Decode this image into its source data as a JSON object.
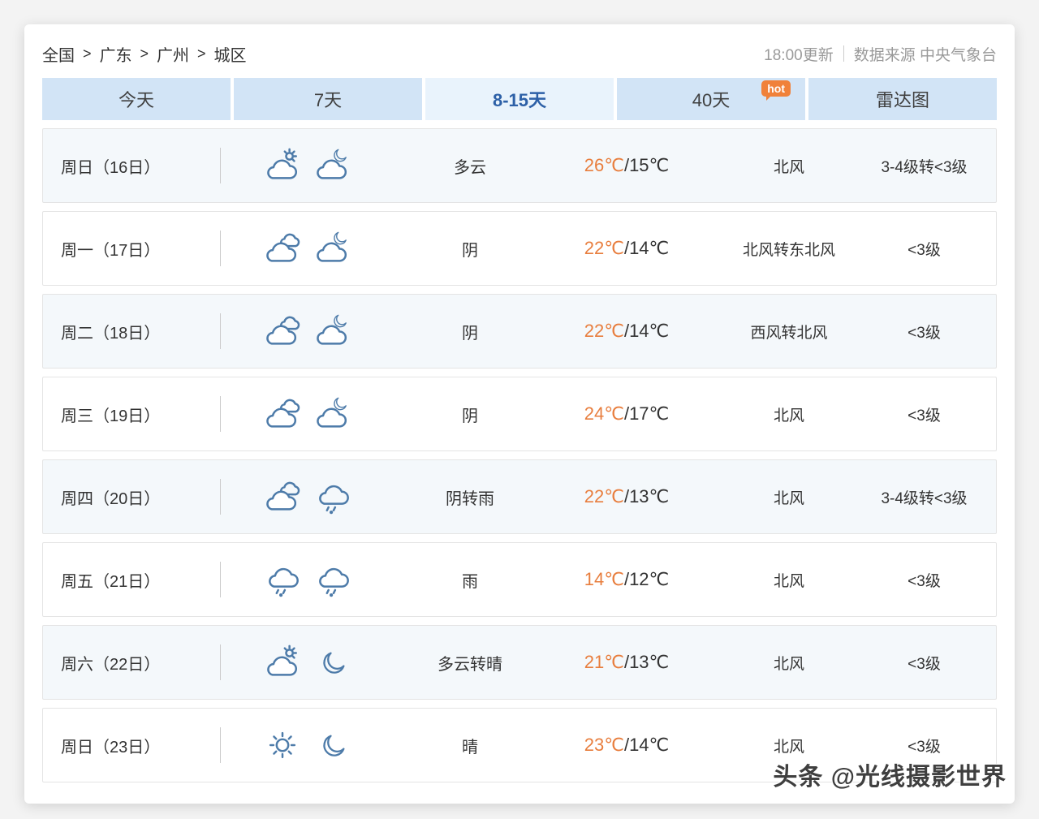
{
  "breadcrumb": {
    "items": [
      "全国",
      "广东",
      "广州",
      "城区"
    ],
    "separator": ">"
  },
  "header": {
    "update_time": "18:00更新",
    "source": "数据来源 中央气象台"
  },
  "tabs": [
    {
      "label": "今天"
    },
    {
      "label": "7天"
    },
    {
      "label": "8-15天",
      "active": true
    },
    {
      "label": "40天",
      "badge": "hot"
    },
    {
      "label": "雷达图"
    }
  ],
  "labels": {
    "temp_separator": "/"
  },
  "forecast": [
    {
      "day": "周日（16日）",
      "icon_day": "cloud-sun",
      "icon_night": "cloud-moon",
      "weather": "多云",
      "temp_high": "26℃",
      "temp_low": "15℃",
      "wind": "北风",
      "wind_scale": "3-4级转<3级"
    },
    {
      "day": "周一（17日）",
      "icon_day": "overcast",
      "icon_night": "cloud-moon",
      "weather": "阴",
      "temp_high": "22℃",
      "temp_low": "14℃",
      "wind": "北风转东北风",
      "wind_scale": "<3级"
    },
    {
      "day": "周二（18日）",
      "icon_day": "overcast",
      "icon_night": "cloud-moon",
      "weather": "阴",
      "temp_high": "22℃",
      "temp_low": "14℃",
      "wind": "西风转北风",
      "wind_scale": "<3级"
    },
    {
      "day": "周三（19日）",
      "icon_day": "overcast",
      "icon_night": "cloud-moon",
      "weather": "阴",
      "temp_high": "24℃",
      "temp_low": "17℃",
      "wind": "北风",
      "wind_scale": "<3级"
    },
    {
      "day": "周四（20日）",
      "icon_day": "overcast",
      "icon_night": "rain",
      "weather": "阴转雨",
      "temp_high": "22℃",
      "temp_low": "13℃",
      "wind": "北风",
      "wind_scale": "3-4级转<3级"
    },
    {
      "day": "周五（21日）",
      "icon_day": "rain",
      "icon_night": "rain",
      "weather": "雨",
      "temp_high": "14℃",
      "temp_low": "12℃",
      "wind": "北风",
      "wind_scale": "<3级"
    },
    {
      "day": "周六（22日）",
      "icon_day": "cloud-sun",
      "icon_night": "moon",
      "weather": "多云转晴",
      "temp_high": "21℃",
      "temp_low": "13℃",
      "wind": "北风",
      "wind_scale": "<3级"
    },
    {
      "day": "周日（23日）",
      "icon_day": "sun",
      "icon_night": "moon",
      "weather": "晴",
      "temp_high": "23℃",
      "temp_low": "14℃",
      "wind": "北风",
      "wind_scale": "<3级"
    }
  ],
  "watermark": "头条 @光线摄影世界",
  "colors": {
    "accent_orange": "#e87e3e",
    "tab_bg": "#d2e4f6",
    "tab_active_bg": "#e9f3fc",
    "tab_active_text": "#2d60a7",
    "icon_stroke": "#4d7ba9",
    "hot_badge": "#f0813a",
    "row_alt_bg": "#f4f8fb"
  }
}
